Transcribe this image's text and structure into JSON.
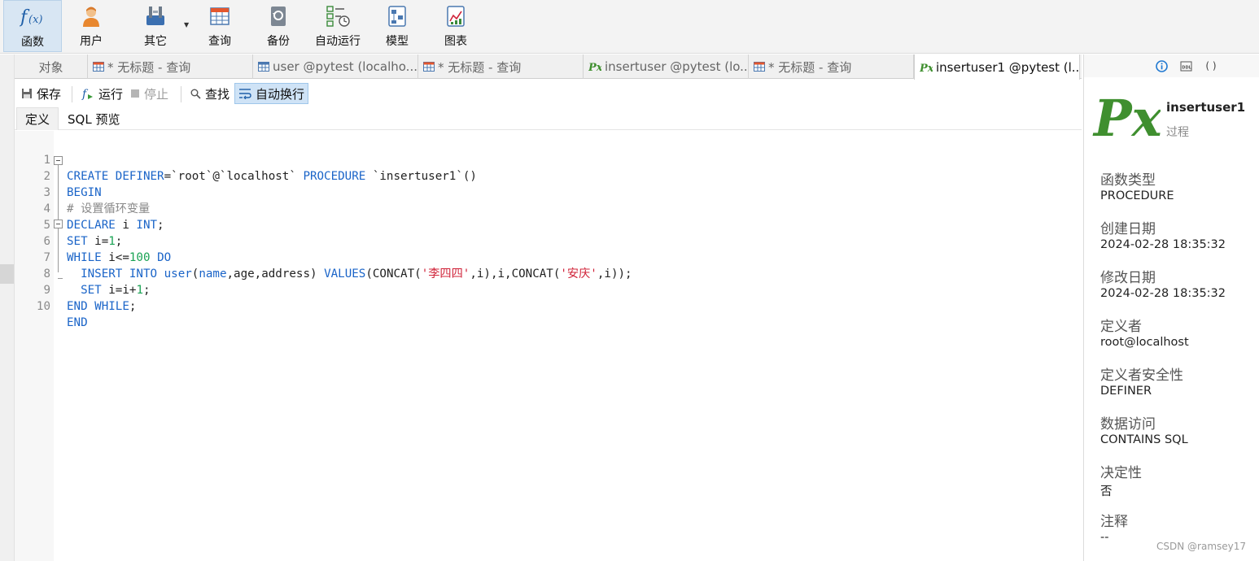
{
  "toolbar": {
    "items": [
      {
        "label": "函数",
        "icon": "function-icon"
      },
      {
        "label": "用户",
        "icon": "user-icon"
      },
      {
        "label": "其它",
        "icon": "tools-icon"
      },
      {
        "label": "查询",
        "icon": "query-icon"
      },
      {
        "label": "备份",
        "icon": "backup-icon"
      },
      {
        "label": "自动运行",
        "icon": "schedule-icon"
      },
      {
        "label": "模型",
        "icon": "model-icon"
      },
      {
        "label": "图表",
        "icon": "chart-icon"
      }
    ],
    "active_item": "函数"
  },
  "tabs": [
    {
      "label": "对象"
    },
    {
      "label": "* 无标题 - 查询",
      "icon": "query-grid-icon"
    },
    {
      "label": "user @pytest (localho...",
      "icon": "table-grid-icon"
    },
    {
      "label": "* 无标题 - 查询",
      "icon": "query-grid-icon"
    },
    {
      "label": "insertuser @pytest (lo...",
      "icon": "procedure-icon"
    },
    {
      "label": "* 无标题 - 查询",
      "icon": "query-grid-icon"
    },
    {
      "label": "insertuser1 @pytest (l...",
      "icon": "procedure-icon",
      "active": true
    }
  ],
  "editor_toolbar": {
    "save": "保存",
    "run": "运行",
    "stop": "停止",
    "find": "查找",
    "word_wrap": "自动换行"
  },
  "subtabs": {
    "definition": "定义",
    "sql_preview": "SQL 预览"
  },
  "code": {
    "line_numbers": [
      "1",
      "2",
      "3",
      "4",
      "5",
      "6",
      "7",
      "8",
      "9",
      "10"
    ],
    "lines": [
      "CREATE DEFINER=`root`@`localhost` PROCEDURE `insertuser1`()",
      "BEGIN",
      "# 设置循环变量",
      "DECLARE i INT;",
      "SET i=1;",
      "WHILE i<=100 DO",
      "  INSERT INTO user(name,age,address) VALUES(CONCAT('李四四',i),i,CONCAT('安庆',i));",
      "  SET i=i+1;",
      "END WHILE;",
      "END"
    ]
  },
  "info_panel": {
    "object_name": "insertuser1",
    "object_type": "过程",
    "properties": [
      {
        "label": "函数类型",
        "value": "PROCEDURE"
      },
      {
        "label": "创建日期",
        "value": "2024-02-28 18:35:32"
      },
      {
        "label": "修改日期",
        "value": "2024-02-28 18:35:32"
      },
      {
        "label": "定义者",
        "value": "root@localhost"
      },
      {
        "label": "定义者安全性",
        "value": "DEFINER"
      },
      {
        "label": "数据访问",
        "value": "CONTAINS SQL"
      },
      {
        "label": "决定性",
        "value": "否"
      },
      {
        "label": "注释",
        "value": "--"
      }
    ],
    "top_icons": [
      "info-icon",
      "ddl-icon",
      "parentheses-icon"
    ],
    "ddl_text": "DDL",
    "paren_text": "( )"
  },
  "watermark": "CSDN @ramsey17",
  "colors": {
    "keyword": "#1a64c8",
    "number": "#1aa354",
    "string": "#d0243a",
    "comment": "#888888",
    "procedure_green": "#3f8f2f",
    "accent_blue": "#1f78d1"
  }
}
